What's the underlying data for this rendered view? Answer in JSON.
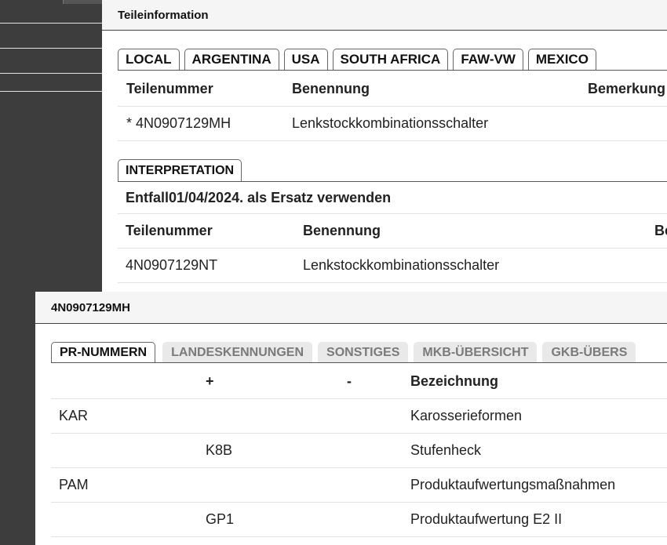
{
  "dialog1": {
    "title": "Teileinformation",
    "tabs": [
      "LOCAL",
      "ARGENTINA",
      "USA",
      "SOUTH AFRICA",
      "FAW-VW",
      "MEXICO"
    ],
    "table": {
      "headers": [
        "Teilenummer",
        "Benennung",
        "Bemerkung"
      ],
      "rows": [
        [
          "* 4N0907129MH",
          "Lenkstockkombinationsschalter",
          ""
        ]
      ]
    },
    "interpretation": {
      "tab": "INTERPRETATION",
      "note": "Entfall01/04/2024. als Ersatz verwenden",
      "headers": [
        "Teilenummer",
        "Benennung",
        "Be"
      ],
      "rows": [
        [
          "4N0907129NT",
          "Lenkstockkombinationsschalter",
          ""
        ]
      ]
    }
  },
  "dialog2": {
    "title": "4N0907129MH",
    "tabs": [
      "PR-NUMMERN",
      "LANDESKENNUNGEN",
      "SONSTIGES",
      "MKB-ÜBERSICHT",
      "GKB-ÜBERS"
    ],
    "table": {
      "headers": [
        "",
        "+",
        "-",
        "Bezeichnung"
      ],
      "rows": [
        [
          "KAR",
          "",
          "",
          "Karosserieformen"
        ],
        [
          "",
          "K8B",
          "",
          "Stufenheck"
        ],
        [
          "PAM",
          "",
          "",
          "Produktaufwertungsmaßnahmen"
        ],
        [
          "",
          "GP1",
          "",
          "Produktaufwertung E2 II"
        ]
      ]
    }
  }
}
